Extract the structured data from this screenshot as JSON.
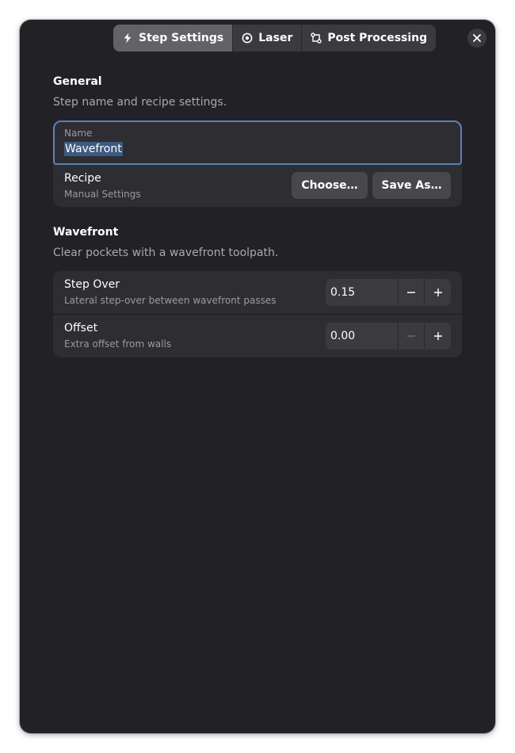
{
  "tabs": [
    {
      "label": "Step Settings",
      "icon": "lightning-icon",
      "active": true
    },
    {
      "label": "Laser",
      "icon": "target-icon",
      "active": false
    },
    {
      "label": "Post Processing",
      "icon": "flow-icon",
      "active": false
    }
  ],
  "general": {
    "title": "General",
    "description": "Step name and recipe settings.",
    "name_label": "Name",
    "name_value": "Wavefront",
    "recipe_title": "Recipe",
    "recipe_value": "Manual Settings",
    "choose_label": "Choose…",
    "save_as_label": "Save As…"
  },
  "wavefront": {
    "title": "Wavefront",
    "description": "Clear pockets with a wavefront toolpath.",
    "step_over": {
      "title": "Step Over",
      "subtitle": "Lateral step-over between wavefront passes",
      "value": "0.15"
    },
    "offset": {
      "title": "Offset",
      "subtitle": "Extra offset from walls",
      "value": "0.00"
    }
  },
  "colors": {
    "window_bg": "#222226",
    "card_bg": "#2e2e32",
    "accent_border": "#5a82b8",
    "selection": "#3d5a80"
  }
}
